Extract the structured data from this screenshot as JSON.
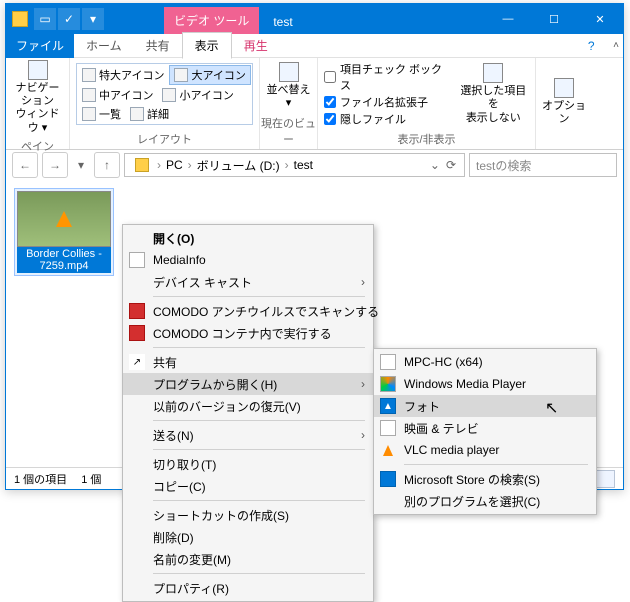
{
  "title": "test",
  "tabtool": "ビデオ ツール",
  "tabs": {
    "file": "ファイル",
    "home": "ホーム",
    "share": "共有",
    "view": "表示",
    "play": "再生"
  },
  "ribbon": {
    "pane": {
      "label": "ペイン",
      "nav": "ナビゲーション\nウィンドウ ▾"
    },
    "layout": {
      "label": "レイアウト",
      "xl": "特大アイコン",
      "l": "大アイコン",
      "m": "中アイコン",
      "s": "小アイコン",
      "list": "一覧",
      "details": "詳細"
    },
    "curview": {
      "label": "現在のビュー",
      "sort": "並べ替え ▾"
    },
    "showhide": {
      "label": "表示/非表示",
      "chk1": "項目チェック ボックス",
      "chk2": "ファイル名拡張子",
      "chk3": "隠しファイル",
      "hidebtn": "選択した項目を\n表示しない"
    },
    "options": {
      "label": "",
      "btn": "オプション"
    }
  },
  "address": {
    "pc": "PC",
    "vol": "ボリューム (D:)",
    "folder": "test"
  },
  "search_placeholder": "testの検索",
  "file": {
    "name": "Border Collies - 7259.mp4"
  },
  "status": {
    "count": "1 個の項目",
    "sel": "1 個"
  },
  "menu": {
    "open": "開く(O)",
    "mediainfo": "MediaInfo",
    "cast": "デバイス キャスト",
    "comodo1": "COMODO アンチウイルスでスキャンする",
    "comodo2": "COMODO コンテナ内で実行する",
    "share": "共有",
    "openwith": "プログラムから開く(H)",
    "prev": "以前のバージョンの復元(V)",
    "send": "送る(N)",
    "cut": "切り取り(T)",
    "copy": "コピー(C)",
    "shortcut": "ショートカットの作成(S)",
    "delete": "削除(D)",
    "rename": "名前の変更(M)",
    "prop": "プロパティ(R)"
  },
  "submenu": {
    "mpc": "MPC-HC (x64)",
    "wmp": "Windows Media Player",
    "photos": "フォト",
    "movies": "映画 & テレビ",
    "vlc": "VLC media player",
    "store": "Microsoft Store の検索(S)",
    "choose": "別のプログラムを選択(C)"
  }
}
